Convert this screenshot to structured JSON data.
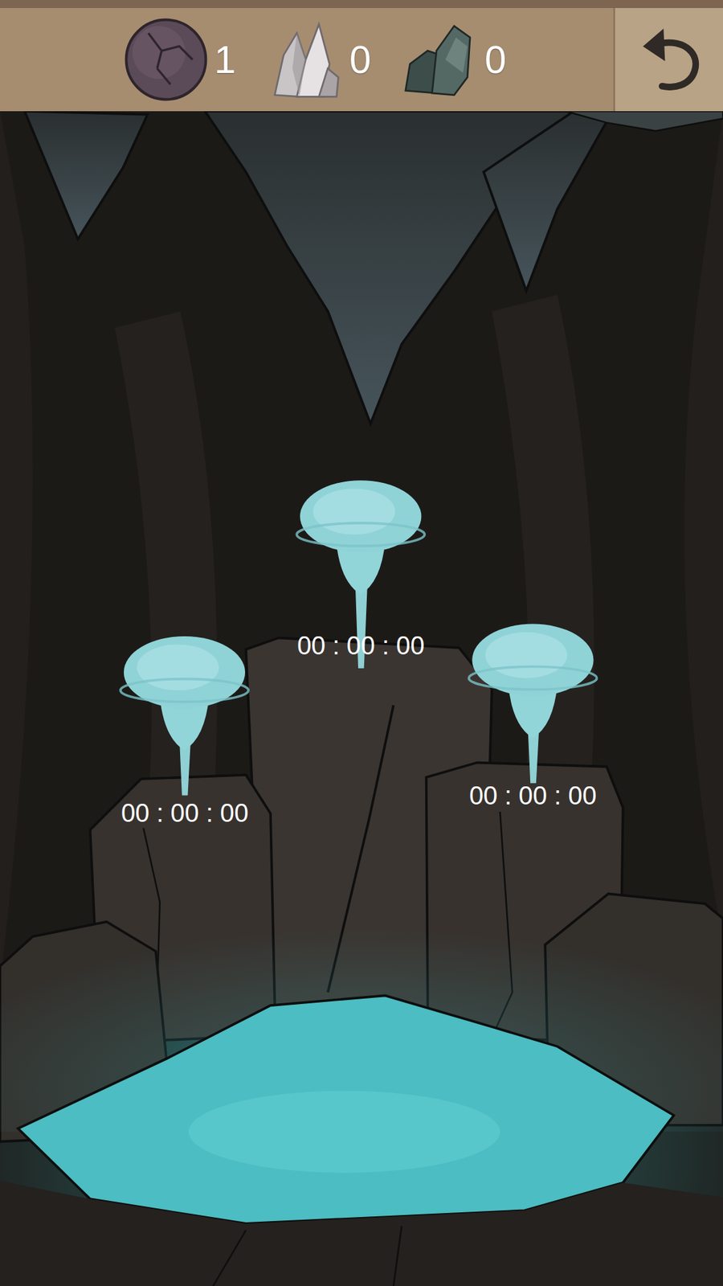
{
  "resources": [
    {
      "kind": "orb",
      "count": "1"
    },
    {
      "kind": "crystal",
      "count": "0"
    },
    {
      "kind": "ore",
      "count": "0"
    }
  ],
  "undo_button": {
    "disabled": false
  },
  "geysers": [
    {
      "timer": "00 : 00 : 00"
    },
    {
      "timer": "00 : 00 : 00"
    },
    {
      "timer": "00 : 00 : 00"
    }
  ]
}
